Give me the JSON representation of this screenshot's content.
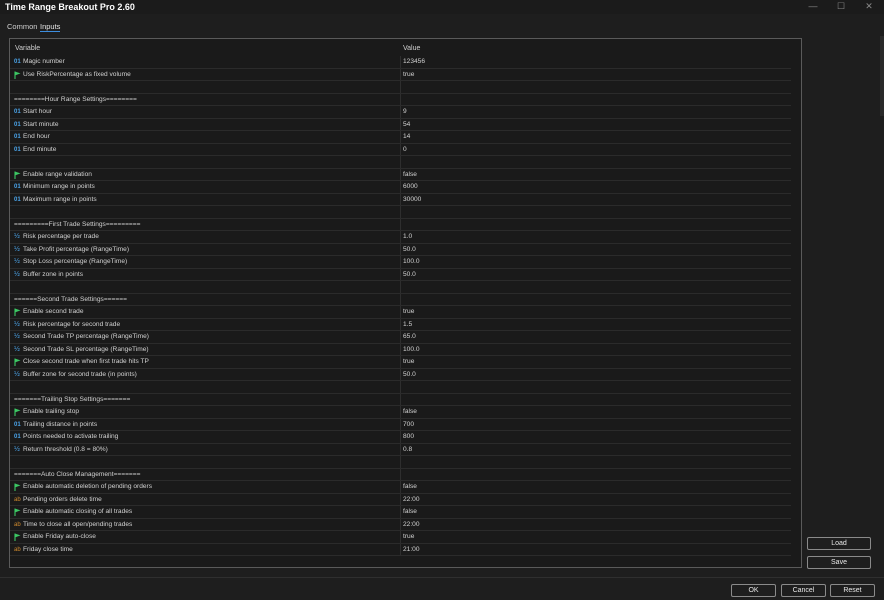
{
  "window": {
    "title": "Time Range Breakout Pro 2.60",
    "minimize_glyph": "—",
    "maximize_glyph": "☐",
    "close_glyph": "✕"
  },
  "tabs": [
    {
      "label": "Common",
      "active": false
    },
    {
      "label": "Inputs",
      "active": true
    }
  ],
  "grid": {
    "header_variable": "Variable",
    "header_value": "Value",
    "rows": [
      {
        "type": "int",
        "label": "Magic number",
        "value": "123456"
      },
      {
        "type": "bool",
        "label": "Use RiskPercentage as fixed volume",
        "value": "true"
      },
      {
        "type": "blank",
        "label": "",
        "value": ""
      },
      {
        "type": "sep",
        "label": "========Hour Range Settings========",
        "value": ""
      },
      {
        "type": "int",
        "label": "Start hour",
        "value": "9"
      },
      {
        "type": "int",
        "label": "Start minute",
        "value": "54"
      },
      {
        "type": "int",
        "label": "End hour",
        "value": "14"
      },
      {
        "type": "int",
        "label": "End minute",
        "value": "0"
      },
      {
        "type": "blank",
        "label": "",
        "value": ""
      },
      {
        "type": "bool",
        "label": "Enable range validation",
        "value": "false"
      },
      {
        "type": "int",
        "label": "Minimum range in points",
        "value": "6000"
      },
      {
        "type": "int",
        "label": "Maximum range in points",
        "value": "30000"
      },
      {
        "type": "blank",
        "label": "",
        "value": ""
      },
      {
        "type": "sep",
        "label": "=========First Trade Settings=========",
        "value": ""
      },
      {
        "type": "dbl",
        "label": "Risk percentage per trade",
        "value": "1.0"
      },
      {
        "type": "dbl",
        "label": "Take Profit percentage (RangeTime)",
        "value": "50.0"
      },
      {
        "type": "dbl",
        "label": "Stop Loss percentage (RangeTime)",
        "value": "100.0"
      },
      {
        "type": "dbl",
        "label": "Buffer zone in points",
        "value": "50.0"
      },
      {
        "type": "blank",
        "label": "",
        "value": ""
      },
      {
        "type": "sep",
        "label": "======Second Trade Settings======",
        "value": ""
      },
      {
        "type": "bool",
        "label": "Enable second trade",
        "value": "true"
      },
      {
        "type": "dbl",
        "label": "Risk percentage for second trade",
        "value": "1.5"
      },
      {
        "type": "dbl",
        "label": "Second Trade TP percentage (RangeTime)",
        "value": "65.0"
      },
      {
        "type": "dbl",
        "label": "Second Trade SL percentage (RangeTime)",
        "value": "100.0"
      },
      {
        "type": "bool",
        "label": "Close second trade when first trade hits TP",
        "value": "true"
      },
      {
        "type": "dbl",
        "label": "Buffer zone for second trade (in points)",
        "value": "50.0"
      },
      {
        "type": "blank",
        "label": "",
        "value": ""
      },
      {
        "type": "sep",
        "label": "=======Trailing Stop Settings=======",
        "value": ""
      },
      {
        "type": "bool",
        "label": "Enable trailing stop",
        "value": "false"
      },
      {
        "type": "int",
        "label": "Trailing distance in points",
        "value": "700"
      },
      {
        "type": "int",
        "label": "Points needed to activate trailing",
        "value": "800"
      },
      {
        "type": "dbl",
        "label": "Return threshold (0.8 = 80%)",
        "value": "0.8"
      },
      {
        "type": "blank",
        "label": "",
        "value": ""
      },
      {
        "type": "sep",
        "label": "=======Auto Close Management=======",
        "value": ""
      },
      {
        "type": "bool",
        "label": "Enable automatic deletion of pending orders",
        "value": "false"
      },
      {
        "type": "str",
        "label": "Pending orders delete time",
        "value": "22:00"
      },
      {
        "type": "bool",
        "label": "Enable automatic closing of all trades",
        "value": "false"
      },
      {
        "type": "str",
        "label": "Time to close all open/pending trades",
        "value": "22:00"
      },
      {
        "type": "bool",
        "label": "Enable Friday auto-close",
        "value": "true"
      },
      {
        "type": "str",
        "label": "Friday close time",
        "value": "21:00"
      }
    ]
  },
  "icons": {
    "int": "01",
    "dbl": "½",
    "str": "ab",
    "bool": "flag-icon"
  },
  "colors": {
    "int_icon": "#4aa3e8",
    "bool_icon": "#3cc864",
    "str_icon": "#d08b2e"
  },
  "buttons": {
    "load": "Load",
    "save": "Save",
    "ok": "OK",
    "cancel": "Cancel",
    "reset": "Reset"
  }
}
